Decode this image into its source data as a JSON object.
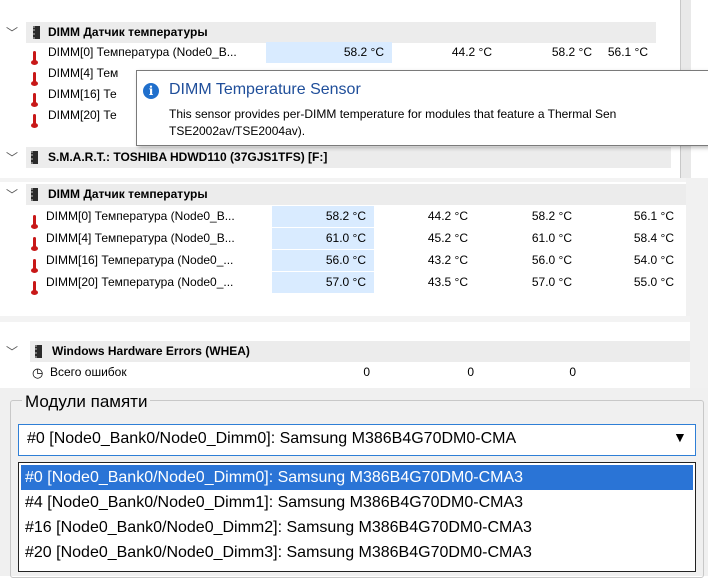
{
  "group1": {
    "title": "DIMM Датчик температуры",
    "rows": [
      {
        "name": "DIMM[0] Температура (Node0_B...",
        "cur": "58.2 °C",
        "min": "44.2 °C",
        "max": "58.2 °C",
        "avg": "56.1 °C"
      },
      {
        "name": "DIMM[4] Тем"
      },
      {
        "name": "DIMM[16] Те"
      },
      {
        "name": "DIMM[20] Те"
      }
    ]
  },
  "tooltip": {
    "title": "DIMM Temperature Sensor",
    "line1": "This sensor provides per-DIMM temperature for modules that feature a Thermal Sen",
    "line2": "TSE2002av/TSE2004av)."
  },
  "smart": {
    "title": "S.M.A.R.T.: TOSHIBA HDWD110 (37GJS1TFS) [F:]"
  },
  "group2": {
    "title": "DIMM Датчик температуры",
    "rows": [
      {
        "name": "DIMM[0] Температура (Node0_B...",
        "cur": "58.2 °C",
        "min": "44.2 °C",
        "max": "58.2 °C",
        "avg": "56.1 °C"
      },
      {
        "name": "DIMM[4] Температура (Node0_B...",
        "cur": "61.0 °C",
        "min": "45.2 °C",
        "max": "61.0 °C",
        "avg": "58.4 °C"
      },
      {
        "name": "DIMM[16] Температура (Node0_...",
        "cur": "56.0 °C",
        "min": "43.2 °C",
        "max": "56.0 °C",
        "avg": "54.0 °C"
      },
      {
        "name": "DIMM[20] Температура (Node0_...",
        "cur": "57.0 °C",
        "min": "43.5 °C",
        "max": "57.0 °C",
        "avg": "55.0 °C"
      }
    ]
  },
  "whea": {
    "title": "Windows Hardware Errors (WHEA)",
    "row": {
      "name": "Всего ошибок",
      "v1": "0",
      "v2": "0",
      "v3": "0"
    }
  },
  "memory": {
    "legend": "Модули памяти",
    "selected": "#0 [Node0_Bank0/Node0_Dimm0]: Samsung M386B4G70DM0-CMA",
    "options": [
      "#0 [Node0_Bank0/Node0_Dimm0]: Samsung M386B4G70DM0-CMA3",
      "#4 [Node0_Bank0/Node0_Dimm1]: Samsung M386B4G70DM0-CMA3",
      "#16 [Node0_Bank0/Node0_Dimm2]: Samsung M386B4G70DM0-CMA3",
      "#20 [Node0_Bank0/Node0_Dimm3]: Samsung M386B4G70DM0-CMA3"
    ]
  },
  "colors": {
    "selection": "#2a74d6",
    "accent": "#1f6fcc",
    "thermometer": "#c81818",
    "current_bg": "#d9ebff"
  }
}
